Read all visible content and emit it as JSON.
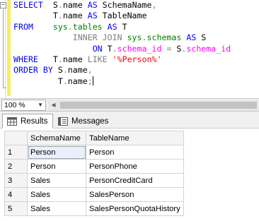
{
  "editor": {
    "collapse_glyph": "−",
    "lines": [
      [
        {
          "t": "SELECT",
          "c": "kw"
        },
        {
          "t": "  S",
          "c": ""
        },
        {
          "t": ".",
          "c": "gray"
        },
        {
          "t": "name ",
          "c": ""
        },
        {
          "t": "AS",
          "c": "kw"
        },
        {
          "t": " SchemaName",
          "c": ""
        },
        {
          "t": ",",
          "c": "gray"
        }
      ],
      [
        {
          "t": "        T",
          "c": ""
        },
        {
          "t": ".",
          "c": "gray"
        },
        {
          "t": "name ",
          "c": ""
        },
        {
          "t": "AS",
          "c": "kw"
        },
        {
          "t": " TableName",
          "c": ""
        }
      ],
      [
        {
          "t": "FROM",
          "c": "kw"
        },
        {
          "t": "    ",
          "c": ""
        },
        {
          "t": "sys",
          "c": "sys"
        },
        {
          "t": ".",
          "c": "gray"
        },
        {
          "t": "tables",
          "c": "sys"
        },
        {
          "t": " ",
          "c": ""
        },
        {
          "t": "AS",
          "c": "kw"
        },
        {
          "t": " T",
          "c": ""
        }
      ],
      [
        {
          "t": "            ",
          "c": ""
        },
        {
          "t": "INNER JOIN",
          "c": "gray"
        },
        {
          "t": " ",
          "c": ""
        },
        {
          "t": "sys",
          "c": "sys"
        },
        {
          "t": ".",
          "c": "gray"
        },
        {
          "t": "schemas",
          "c": "sys"
        },
        {
          "t": " ",
          "c": ""
        },
        {
          "t": "AS",
          "c": "kw"
        },
        {
          "t": " S",
          "c": ""
        }
      ],
      [
        {
          "t": "                ",
          "c": ""
        },
        {
          "t": "ON",
          "c": "kw"
        },
        {
          "t": " T",
          "c": ""
        },
        {
          "t": ".",
          "c": "gray"
        },
        {
          "t": "schema_id",
          "c": "pink"
        },
        {
          "t": " ",
          "c": ""
        },
        {
          "t": "=",
          "c": "gray"
        },
        {
          "t": " S",
          "c": ""
        },
        {
          "t": ".",
          "c": "gray"
        },
        {
          "t": "schema_id",
          "c": "pink"
        }
      ],
      [
        {
          "t": "WHERE",
          "c": "kw"
        },
        {
          "t": "   T",
          "c": ""
        },
        {
          "t": ".",
          "c": "gray"
        },
        {
          "t": "name ",
          "c": ""
        },
        {
          "t": "LIKE",
          "c": "gray"
        },
        {
          "t": " ",
          "c": ""
        },
        {
          "t": "'%Person%'",
          "c": "str"
        }
      ],
      [
        {
          "t": "ORDER BY",
          "c": "kw"
        },
        {
          "t": " S",
          "c": ""
        },
        {
          "t": ".",
          "c": "gray"
        },
        {
          "t": "name",
          "c": ""
        },
        {
          "t": ",",
          "c": "gray"
        }
      ],
      [
        {
          "t": "         T",
          "c": ""
        },
        {
          "t": ".",
          "c": "gray"
        },
        {
          "t": "name",
          "c": ""
        },
        {
          "t": ";",
          "c": "gray"
        }
      ],
      []
    ]
  },
  "zoom": {
    "value": "100 %"
  },
  "tabs": {
    "results_label": "Results",
    "messages_label": "Messages"
  },
  "grid": {
    "columns": [
      "SchemaName",
      "TableName"
    ],
    "rows": [
      {
        "num": "1",
        "cells": [
          "Person",
          "Person"
        ]
      },
      {
        "num": "2",
        "cells": [
          "Person",
          "PersonPhone"
        ]
      },
      {
        "num": "3",
        "cells": [
          "Sales",
          "PersonCreditCard"
        ]
      },
      {
        "num": "4",
        "cells": [
          "Sales",
          "SalesPerson"
        ]
      },
      {
        "num": "5",
        "cells": [
          "Sales",
          "SalesPersonQuotaHistory"
        ]
      }
    ]
  },
  "colors": {
    "change_bar": "#f6ef5d",
    "keyword": "#0000ff",
    "string": "#ff0000",
    "system": "#008000",
    "column": "#ff00ff",
    "operator": "#808080",
    "selection": "#e9f0fb"
  },
  "icons": {
    "results": "grid-icon",
    "messages": "messages-icon",
    "zoom_dropdown": "chevron-down-icon",
    "scroll_left": "arrow-left-icon"
  }
}
